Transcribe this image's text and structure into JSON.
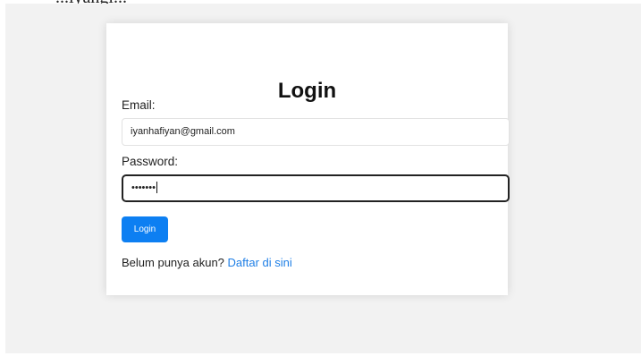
{
  "top_partial_text": "...iyangl...",
  "form": {
    "title": "Login",
    "email_label": "Email:",
    "email_value": "iyanhafiyan@gmail.com",
    "password_label": "Password:",
    "password_masked": "•••••••",
    "submit_label": "Login"
  },
  "register": {
    "prompt": "Belum punya akun?",
    "link_text": "Daftar di sini"
  },
  "colors": {
    "background": "#f2f2f2",
    "card": "#ffffff",
    "primary": "#0d7ff2",
    "link": "#1f7fe6"
  }
}
